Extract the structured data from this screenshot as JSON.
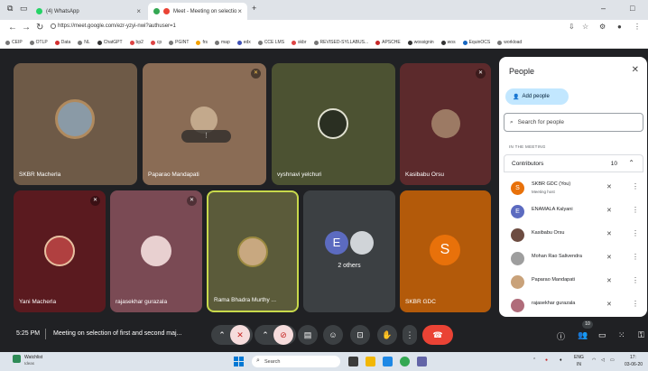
{
  "browser": {
    "tab1_title": "(4) WhatsApp",
    "tab2_title": "Meet - Meeting on selectio",
    "url": "https://meet.google.com/ezr-yzyi-nwi?authuser=1",
    "bookmarks": [
      "CEIP",
      "OTLP",
      "Data",
      "NL",
      "ChatGPT",
      "bp2",
      "cp",
      "PGINT",
      "frs",
      "map",
      "edx",
      "CCE LMS",
      "skbr",
      "REVISED-SYLLABUS...",
      "APSCHE",
      "wossignin",
      "wos",
      "EquinOCS",
      "workload"
    ]
  },
  "tiles": {
    "t1_name": "SKBR Macherla",
    "t2_name": "Paparao Mandapati",
    "t3_name": "vyshnavi yelchuri",
    "t4_name": "Kasibabu Orsu",
    "t5_name": "Yani Macherla",
    "t6_name": "rajasekhar gurazala",
    "t7_name": "Rama Bhadra Murthy ...",
    "t8_name": "2 others",
    "t8_initial": "E",
    "t9_name": "SKBR GDC",
    "t9_initial": "S"
  },
  "controls": {
    "time": "5:25 PM",
    "meeting_title": "Meeting on selection of first and second maj...",
    "people_badge": "10"
  },
  "panel": {
    "title": "People",
    "add_people": "Add people",
    "search_placeholder": "Search for people",
    "section": "IN THE MEETING",
    "contributors_label": "Contributors",
    "contributors_count": "10",
    "people": [
      {
        "initial": "S",
        "name": "SKBR GDC (You)",
        "sub": "Meeting host",
        "color": "#e8710a"
      },
      {
        "initial": "E",
        "name": "ENAMALA Kalyani",
        "sub": "",
        "color": "#5c6bc0"
      },
      {
        "initial": "",
        "name": "Kasibabu Orsu",
        "sub": "",
        "color": "#6d4c41"
      },
      {
        "initial": "",
        "name": "Mohan Rao Salivendra",
        "sub": "",
        "color": "#9e9e9e"
      },
      {
        "initial": "",
        "name": "Paparao Mandapati",
        "sub": "",
        "color": "#c9a27a"
      },
      {
        "initial": "",
        "name": "rajasekhar gurazala",
        "sub": "",
        "color": "#b06c7a"
      }
    ]
  },
  "taskbar": {
    "watch_title": "Watchlist",
    "watch_sub": "Ideas",
    "search": "Search",
    "tray_lang": "ENG",
    "tray_region": "IN",
    "tray_time": "17:",
    "tray_date": "03-06-20"
  }
}
